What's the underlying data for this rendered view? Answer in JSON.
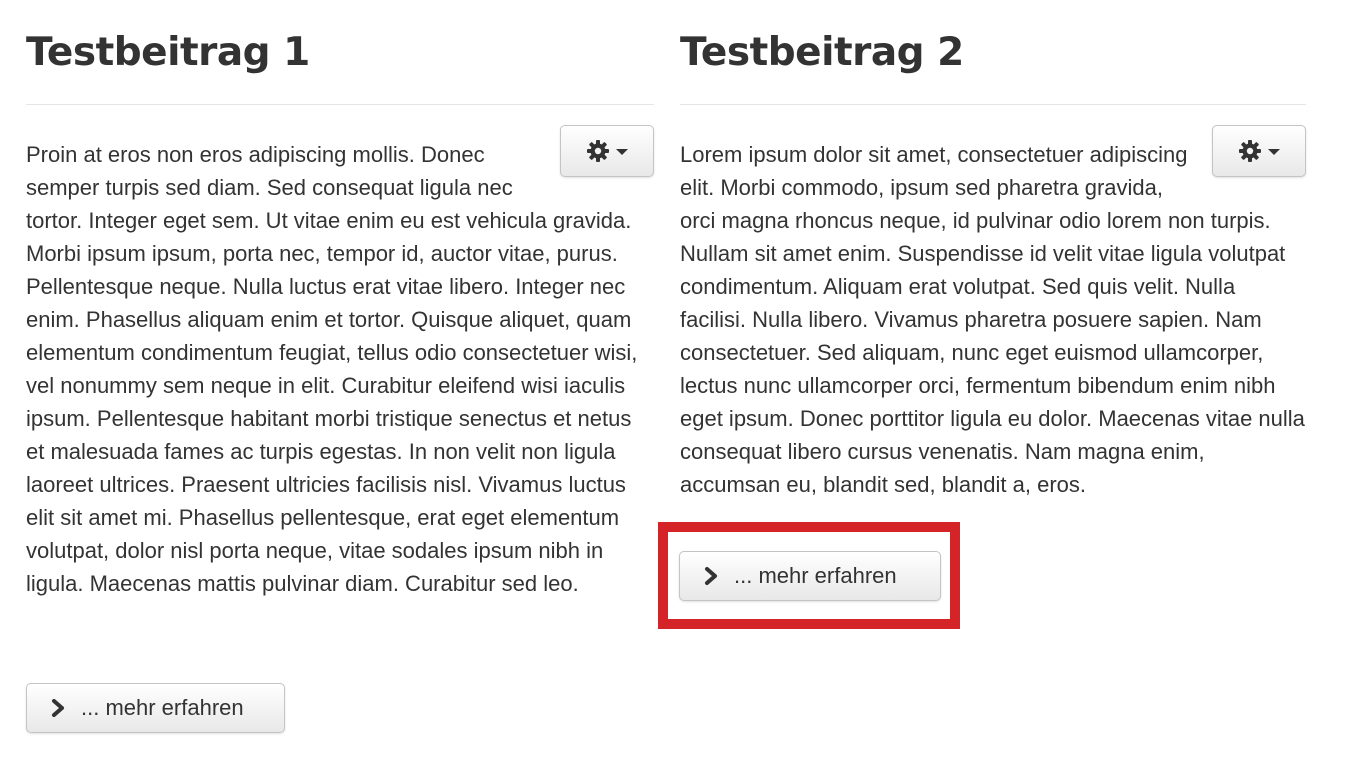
{
  "articles": [
    {
      "title": "Testbeitrag 1",
      "body": "Proin at eros non eros adipiscing mollis. Donec semper turpis sed diam. Sed consequat ligula nec tortor. Integer eget sem. Ut vitae enim eu est vehicula gravida. Morbi ipsum ipsum, porta nec, tempor id, auctor vitae, purus. Pellentesque neque. Nulla luctus erat vitae libero. Integer nec enim. Phasellus aliquam enim et tortor. Quisque aliquet, quam elementum condimentum feugiat, tellus odio consectetuer wisi, vel nonummy sem neque in elit. Curabitur eleifend wisi iaculis ipsum. Pellentesque habitant morbi tristique senectus et netus et malesuada fames ac turpis egestas. In non velit non ligula laoreet ultrices. Praesent ultricies facilisis nisl. Vivamus luctus elit sit amet mi. Phasellus pellentesque, erat eget elementum volutpat, dolor nisl porta neque, vitae sodales ipsum nibh in ligula. Maecenas mattis pulvinar diam. Curabitur sed leo.",
      "more_label": "... mehr erfahren",
      "settings_icon": "gear-icon"
    },
    {
      "title": "Testbeitrag 2",
      "body": "Lorem ipsum dolor sit amet, consectetuer adipiscing elit. Morbi commodo, ipsum sed pharetra gravida, orci magna rhoncus neque, id pulvinar odio lorem non turpis. Nullam sit amet enim. Suspendisse id velit vitae ligula volutpat condimentum. Aliquam erat volutpat. Sed quis velit. Nulla facilisi. Nulla libero. Vivamus pharetra posuere sapien. Nam consectetuer. Sed aliquam, nunc eget euismod ullamcorper, lectus nunc ullamcorper orci, fermentum bibendum enim nibh eget ipsum. Donec porttitor ligula eu dolor. Maecenas vitae nulla consequat libero cursus venenatis. Nam magna enim, accumsan eu, blandit sed, blandit a, eros.",
      "more_label": "... mehr erfahren",
      "settings_icon": "gear-icon"
    }
  ],
  "highlight": {
    "color": "#d42427",
    "target": "article-2-more-button"
  },
  "colors": {
    "text": "#333333",
    "divider": "#e6e6e6",
    "button_border": "#c4c4c4"
  }
}
